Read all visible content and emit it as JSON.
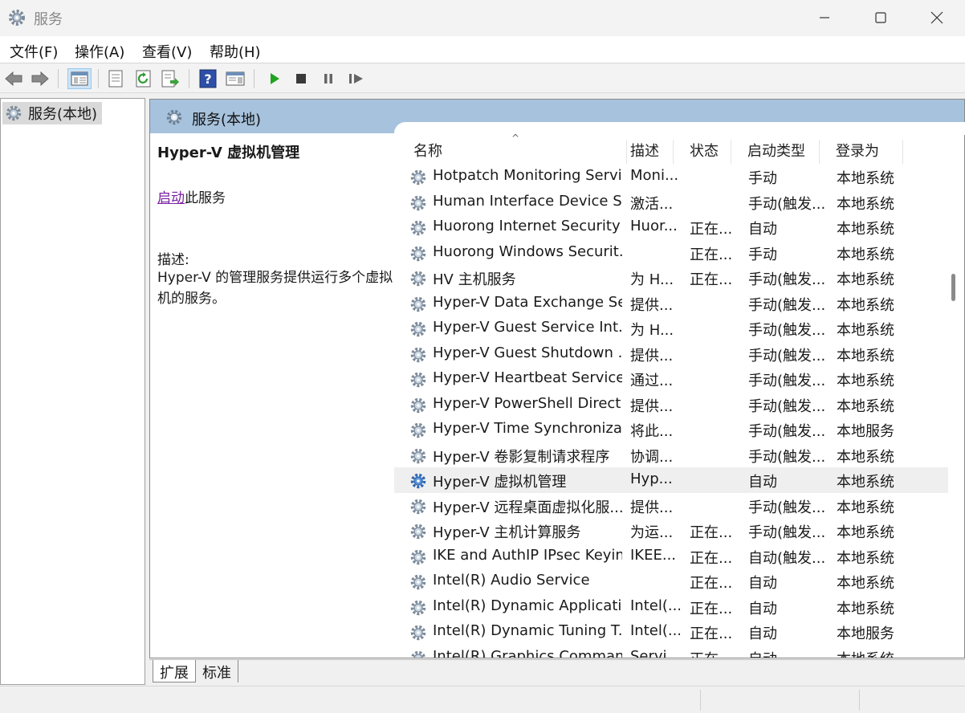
{
  "window": {
    "title": "服务",
    "icon": "gear-icon",
    "controls": [
      "minimize-icon",
      "maximize-icon",
      "close-icon"
    ]
  },
  "menu": {
    "items": [
      "文件(F)",
      "操作(A)",
      "查看(V)",
      "帮助(H)"
    ]
  },
  "toolbar": {
    "buttons": [
      "back-icon",
      "forward-icon",
      "console-tree-icon",
      "properties-icon",
      "refresh-icon",
      "export-list-icon",
      "help-icon",
      "show-hide-action-pane-icon",
      "start-service-icon",
      "stop-service-icon",
      "pause-service-icon",
      "restart-service-icon"
    ]
  },
  "tree": {
    "root_label": "服务(本地)"
  },
  "pane": {
    "title": "服务(本地)"
  },
  "description": {
    "service_name": "Hyper-V 虚拟机管理",
    "start_link": "启动",
    "start_suffix": "此服务",
    "label": "描述:",
    "text": "Hyper-V 的管理服务提供运行多个虚拟机的服务。"
  },
  "columns": {
    "name": "名称",
    "desc": "描述",
    "status": "状态",
    "start_type": "启动类型",
    "login_as": "登录为"
  },
  "services": [
    {
      "name": "Hotpatch Monitoring Service",
      "desc": "Moni...",
      "status": "",
      "start": "手动",
      "login": "本地系统"
    },
    {
      "name": "Human Interface Device S...",
      "desc": "激活...",
      "status": "",
      "start": "手动(触发...",
      "login": "本地系统"
    },
    {
      "name": "Huorong Internet Security ...",
      "desc": "Huor...",
      "status": "正在...",
      "start": "自动",
      "login": "本地系统"
    },
    {
      "name": "Huorong Windows Securit...",
      "desc": "",
      "status": "正在...",
      "start": "手动",
      "login": "本地系统"
    },
    {
      "name": "HV 主机服务",
      "desc": "为 H...",
      "status": "正在...",
      "start": "手动(触发...",
      "login": "本地系统"
    },
    {
      "name": "Hyper-V Data Exchange Se...",
      "desc": "提供...",
      "status": "",
      "start": "手动(触发...",
      "login": "本地系统"
    },
    {
      "name": "Hyper-V Guest Service Int...",
      "desc": "为 H...",
      "status": "",
      "start": "手动(触发...",
      "login": "本地系统"
    },
    {
      "name": "Hyper-V Guest Shutdown ...",
      "desc": "提供...",
      "status": "",
      "start": "手动(触发...",
      "login": "本地系统"
    },
    {
      "name": "Hyper-V Heartbeat Service",
      "desc": "通过...",
      "status": "",
      "start": "手动(触发...",
      "login": "本地系统"
    },
    {
      "name": "Hyper-V PowerShell Direct...",
      "desc": "提供...",
      "status": "",
      "start": "手动(触发...",
      "login": "本地系统"
    },
    {
      "name": "Hyper-V Time Synchroniza...",
      "desc": "将此...",
      "status": "",
      "start": "手动(触发...",
      "login": "本地服务"
    },
    {
      "name": "Hyper-V 卷影复制请求程序",
      "desc": "协调...",
      "status": "",
      "start": "手动(触发...",
      "login": "本地系统"
    },
    {
      "name": "Hyper-V 虚拟机管理",
      "desc": "Hyp...",
      "status": "",
      "start": "自动",
      "login": "本地系统",
      "selected": true
    },
    {
      "name": "Hyper-V 远程桌面虚拟化服...",
      "desc": "提供...",
      "status": "",
      "start": "手动(触发...",
      "login": "本地系统"
    },
    {
      "name": "Hyper-V 主机计算服务",
      "desc": "为运...",
      "status": "正在...",
      "start": "手动(触发...",
      "login": "本地系统"
    },
    {
      "name": "IKE and AuthIP IPsec Keyin...",
      "desc": "IKEE...",
      "status": "正在...",
      "start": "自动(触发...",
      "login": "本地系统"
    },
    {
      "name": "Intel(R) Audio Service",
      "desc": "",
      "status": "正在...",
      "start": "自动",
      "login": "本地系统"
    },
    {
      "name": "Intel(R) Dynamic Applicati...",
      "desc": "Intel(...",
      "status": "正在...",
      "start": "自动",
      "login": "本地系统"
    },
    {
      "name": "Intel(R) Dynamic Tuning T...",
      "desc": "Intel(...",
      "status": "正在...",
      "start": "自动",
      "login": "本地服务"
    },
    {
      "name": "Intel(R) Graphics Comman...",
      "desc": "Servi...",
      "status": "正在...",
      "start": "自动",
      "login": "本地系统"
    }
  ],
  "bottom_tabs": [
    "扩展",
    "标准"
  ]
}
